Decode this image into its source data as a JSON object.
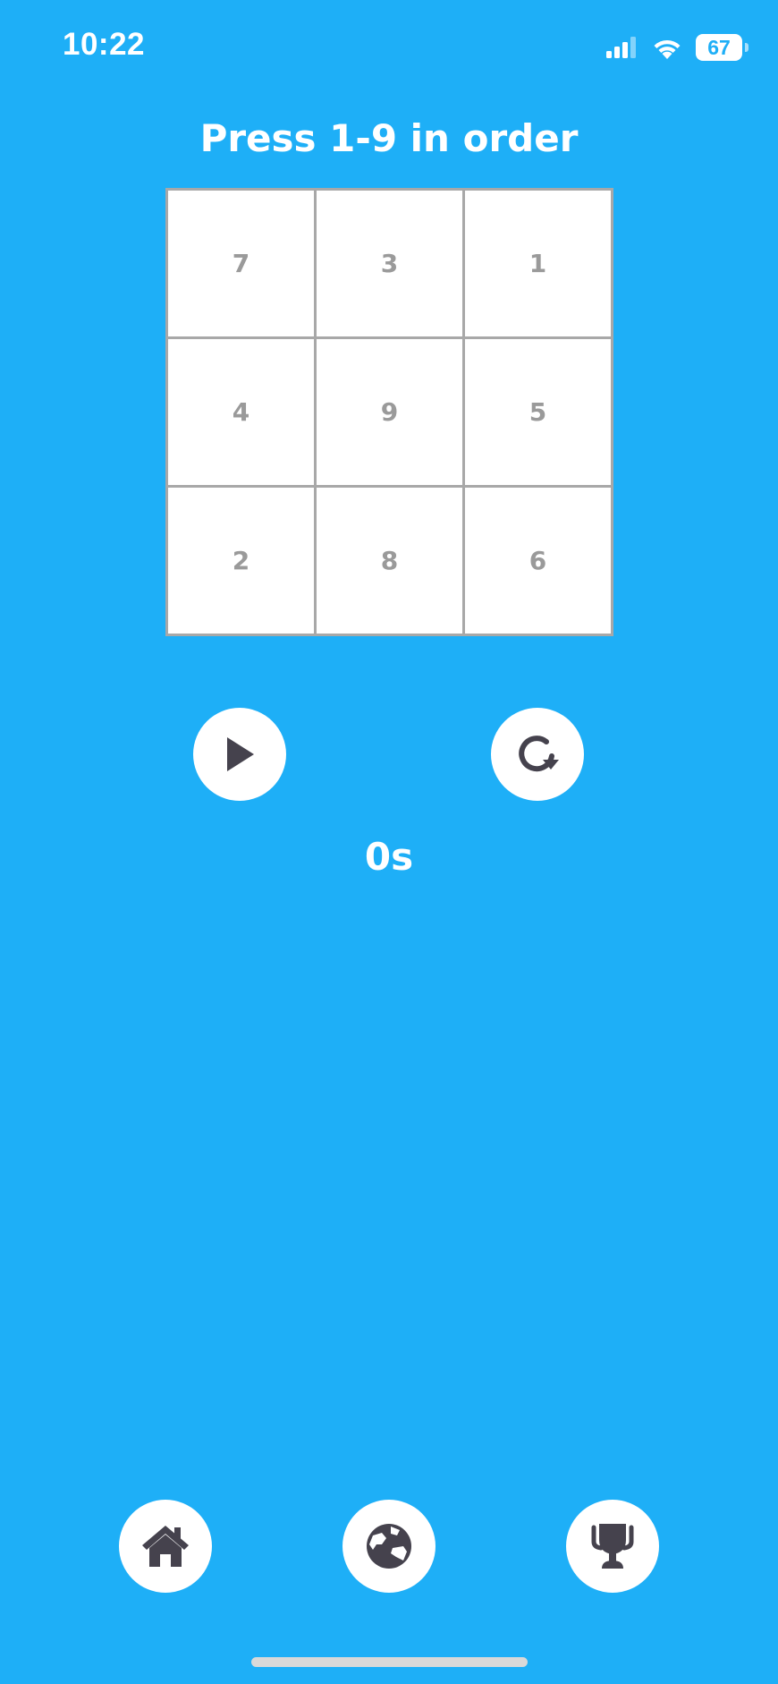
{
  "status_bar": {
    "time": "10:22",
    "battery_level": "67",
    "icons": [
      "cellular-signal-icon",
      "wifi-icon",
      "battery-icon"
    ]
  },
  "game": {
    "title": "Press 1-9 in order",
    "grid": [
      "7",
      "3",
      "1",
      "4",
      "9",
      "5",
      "2",
      "8",
      "6"
    ],
    "timer": "0s"
  },
  "controls": {
    "play_icon": "play-icon",
    "restart_icon": "restart-icon"
  },
  "bottom_nav": {
    "items": [
      "home-icon",
      "globe-icon",
      "trophy-icon"
    ]
  },
  "colors": {
    "background": "#1eaff7",
    "icon": "#45424d",
    "grid_line": "#a8a8a8",
    "cell_text": "#9a9a9a"
  }
}
